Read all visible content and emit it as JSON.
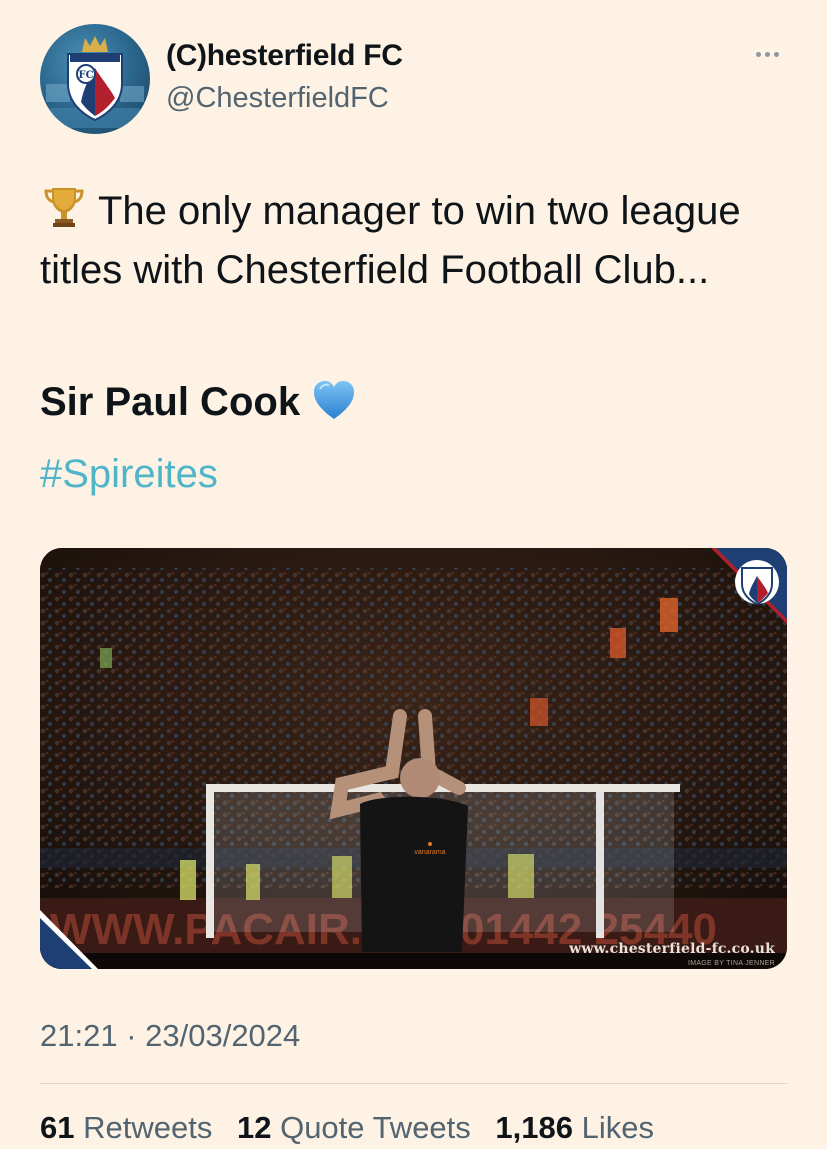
{
  "account": {
    "display_name": "(C)hesterfield FC",
    "handle": "@ChesterfieldFC",
    "avatar_icon": "club-crest-icon",
    "more_icon": "more-options-icon"
  },
  "tweet": {
    "text": "The only manager to win two league titles with Chesterfield Football Club...",
    "emphasis": "Sir Paul Cook",
    "hashtag": "#Spireites",
    "leading_emoji": "trophy-icon",
    "trailing_emoji": "blue-heart-icon"
  },
  "media": {
    "watermark_url": "www.chesterfield-fc.co.uk",
    "credit": "IMAGE BY TINA JENNER",
    "board_text_left": "WWW.PACAIR.CO",
    "board_text_right": "01442 25440",
    "shirt_text": "vanarama"
  },
  "meta": {
    "timestamp": "21:21 · 23/03/2024"
  },
  "stats": {
    "retweets": {
      "count": "61",
      "label": "Retweets"
    },
    "quotes": {
      "count": "12",
      "label": "Quote Tweets"
    },
    "likes": {
      "count": "1,186",
      "label": "Likes"
    }
  },
  "colors": {
    "background": "#fdf2e3",
    "hashtag": "#50b5c9",
    "secondary_text": "#536471",
    "club_blue": "#1d3f74",
    "club_red": "#b1202c"
  }
}
